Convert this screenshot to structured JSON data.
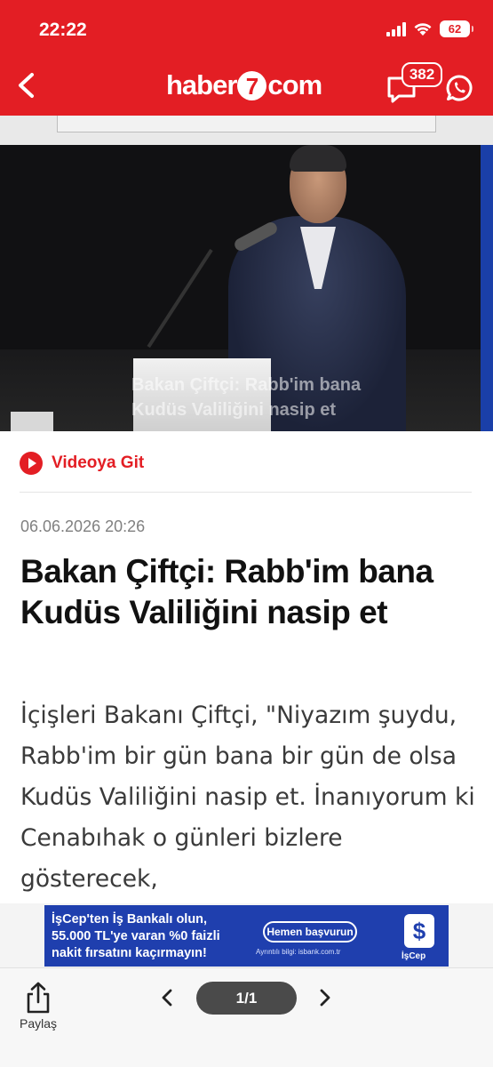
{
  "status_bar": {
    "time": "22:22",
    "battery": "62"
  },
  "header": {
    "logo_prefix": "haber",
    "logo_number": "7",
    "logo_suffix": "com",
    "comment_count": "382",
    "brand_color": "#e31e24"
  },
  "hero": {
    "caption_line1": "Bakan Çiftçi: Rabb'im bana",
    "caption_line2": "Kudüs Valiliğini nasip et"
  },
  "article": {
    "video_link_label": "Videoya Git",
    "date": "06.06.2026 20:26",
    "headline": "Bakan Çiftçi: Rabb'im bana Kudüs Valiliğini nasip et",
    "summary": "İçişleri Bakanı Çiftçi, \"Niyazım şuydu, Rabb'im bir gün bana bir gün de olsa Kudüs Valiliğini nasip et. İnanıyorum ki Cenabıhak o günleri bizlere gösterecek,"
  },
  "ad": {
    "line1": "İşCep'ten İş Bankalı olun,",
    "line2": "55.000 TL'ye varan %0 faizli",
    "line3": "nakit fırsatını kaçırmayın!",
    "cta": "Hemen başvurun",
    "fine_print": "Ayrıntılı bilgi: isbank.com.tr",
    "brand": "İşCep"
  },
  "toolbar": {
    "share_label": "Paylaş",
    "page_indicator": "1/1"
  },
  "icons": {
    "back": "chevron-left-icon",
    "comments": "comment-bubble-icon",
    "whatsapp": "whatsapp-icon",
    "play": "play-icon",
    "share": "share-icon",
    "prev": "chevron-left-icon",
    "next": "chevron-right-icon"
  }
}
